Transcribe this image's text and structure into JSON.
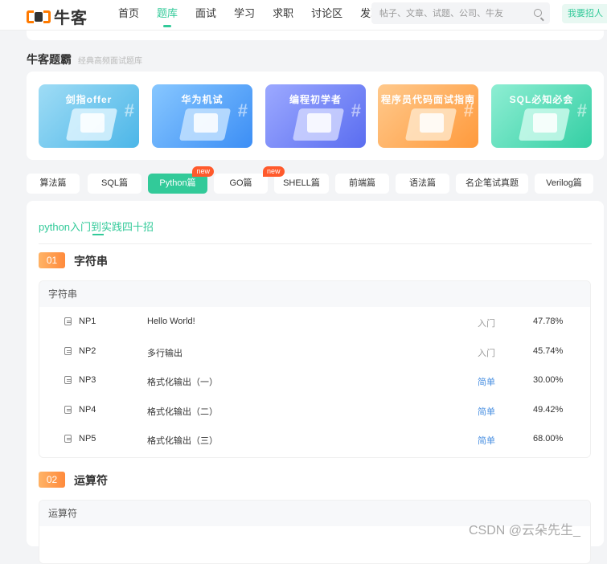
{
  "header": {
    "logo_text": "牛客",
    "nav": [
      "首页",
      "题库",
      "面试",
      "学习",
      "求职",
      "讨论区",
      "发现"
    ],
    "active_nav": "题库",
    "search_placeholder": "帖子、文章、试题、公司、牛友",
    "recruit_label": "我要招人"
  },
  "section": {
    "title": "牛客题霸",
    "subtitle": "经典高频面试题库"
  },
  "banners": [
    {
      "title": "剑指offer",
      "color": "#4cb6e8"
    },
    {
      "title": "华为机试",
      "color": "#3c8ef5"
    },
    {
      "title": "编程初学者",
      "color": "#5a6df0"
    },
    {
      "title": "程序员代码面试指南",
      "color": "#ff9a3c"
    },
    {
      "title": "SQL必知必会",
      "color": "#34cfa4"
    }
  ],
  "tabs": [
    {
      "label": "算法篇"
    },
    {
      "label": "SQL篇"
    },
    {
      "label": "Python篇",
      "active": true,
      "badge": "new"
    },
    {
      "label": "GO篇"
    },
    {
      "label": "SHELL篇",
      "badge": "new"
    },
    {
      "label": "前端篇"
    },
    {
      "label": "语法篇"
    },
    {
      "label": "名企笔试真题"
    },
    {
      "label": "Verilog篇"
    }
  ],
  "subtab": "python入门到实践四十招",
  "chapters": [
    {
      "num": "01",
      "title": "字符串",
      "group_title": "字符串",
      "problems": [
        {
          "id": "NP1",
          "name": "Hello World!",
          "level": "入门",
          "rate": "47.78%"
        },
        {
          "id": "NP2",
          "name": "多行输出",
          "level": "入门",
          "rate": "45.74%"
        },
        {
          "id": "NP3",
          "name": "格式化输出（一）",
          "level": "简单",
          "rate": "30.00%"
        },
        {
          "id": "NP4",
          "name": "格式化输出（二）",
          "level": "简单",
          "rate": "49.42%"
        },
        {
          "id": "NP5",
          "name": "格式化输出（三）",
          "level": "简单",
          "rate": "68.00%"
        }
      ]
    },
    {
      "num": "02",
      "title": "运算符",
      "group_title": "运算符"
    }
  ],
  "colors": {
    "accent": "#32ca99",
    "orange": "#ff8a3c",
    "easy": "#4a90e2"
  },
  "watermark": "CSDN @云朵先生_"
}
